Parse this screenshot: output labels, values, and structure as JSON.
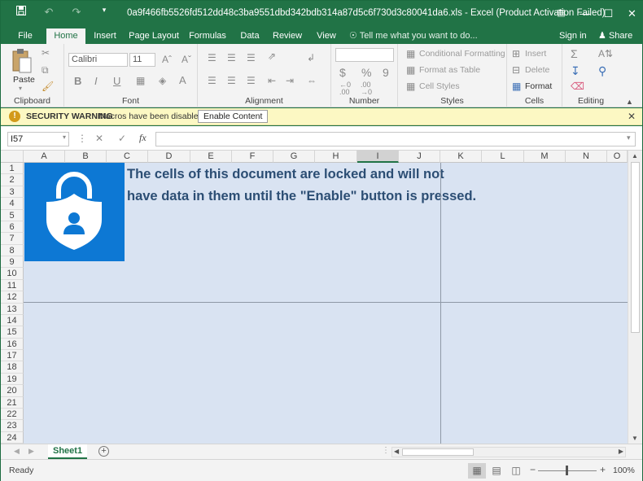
{
  "window": {
    "title": "0a9f466fb5526fd512dd48c3ba9551dbd342bdb314a87d5c6f730d3c80041da6.xls - Excel (Product Activation Failed)"
  },
  "ribbon_tabs": [
    "File",
    "Home",
    "Insert",
    "Page Layout",
    "Formulas",
    "Data",
    "Review",
    "View"
  ],
  "tell_me": "Tell me what you want to do...",
  "sign_in": "Sign in",
  "share": "Share",
  "ribbon": {
    "clipboard": {
      "paste": "Paste",
      "label": "Clipboard"
    },
    "font": {
      "name": "Calibri",
      "size": "11",
      "label": "Font"
    },
    "alignment": {
      "label": "Alignment"
    },
    "number": {
      "label": "Number",
      "currency": "$",
      "percent": "%",
      "comma": "9"
    },
    "styles": {
      "conditional": "Conditional Formatting",
      "table": "Format as Table",
      "cell_styles": "Cell Styles",
      "label": "Styles"
    },
    "cells": {
      "insert": "Insert",
      "delete": "Delete",
      "format": "Format",
      "label": "Cells"
    },
    "editing": {
      "label": "Editing"
    }
  },
  "security": {
    "title": "SECURITY WARNING",
    "message": "Macros have been disabled.",
    "button": "Enable Content"
  },
  "formula_bar": {
    "name_box": "I57",
    "fx": "fx"
  },
  "columns": [
    "A",
    "B",
    "C",
    "D",
    "E",
    "F",
    "G",
    "H",
    "I",
    "J",
    "K",
    "L",
    "M",
    "N",
    "O"
  ],
  "rows": [
    "1",
    "2",
    "3",
    "4",
    "5",
    "6",
    "7",
    "8",
    "9",
    "10",
    "11",
    "12",
    "13",
    "14",
    "15",
    "16",
    "17",
    "18",
    "19",
    "20",
    "21",
    "22",
    "23",
    "24"
  ],
  "message_lines": [
    "The cells of this document are locked and will not",
    "have data in them until the \"Enable\" button is pressed."
  ],
  "sheet_tab": "Sheet1",
  "status": {
    "ready": "Ready",
    "zoom": "100%"
  },
  "colors": {
    "excel_green": "#217346",
    "lock_blue": "#0d78d4",
    "message_text": "#2c4e74",
    "warning_bar": "#fcf8c3"
  }
}
